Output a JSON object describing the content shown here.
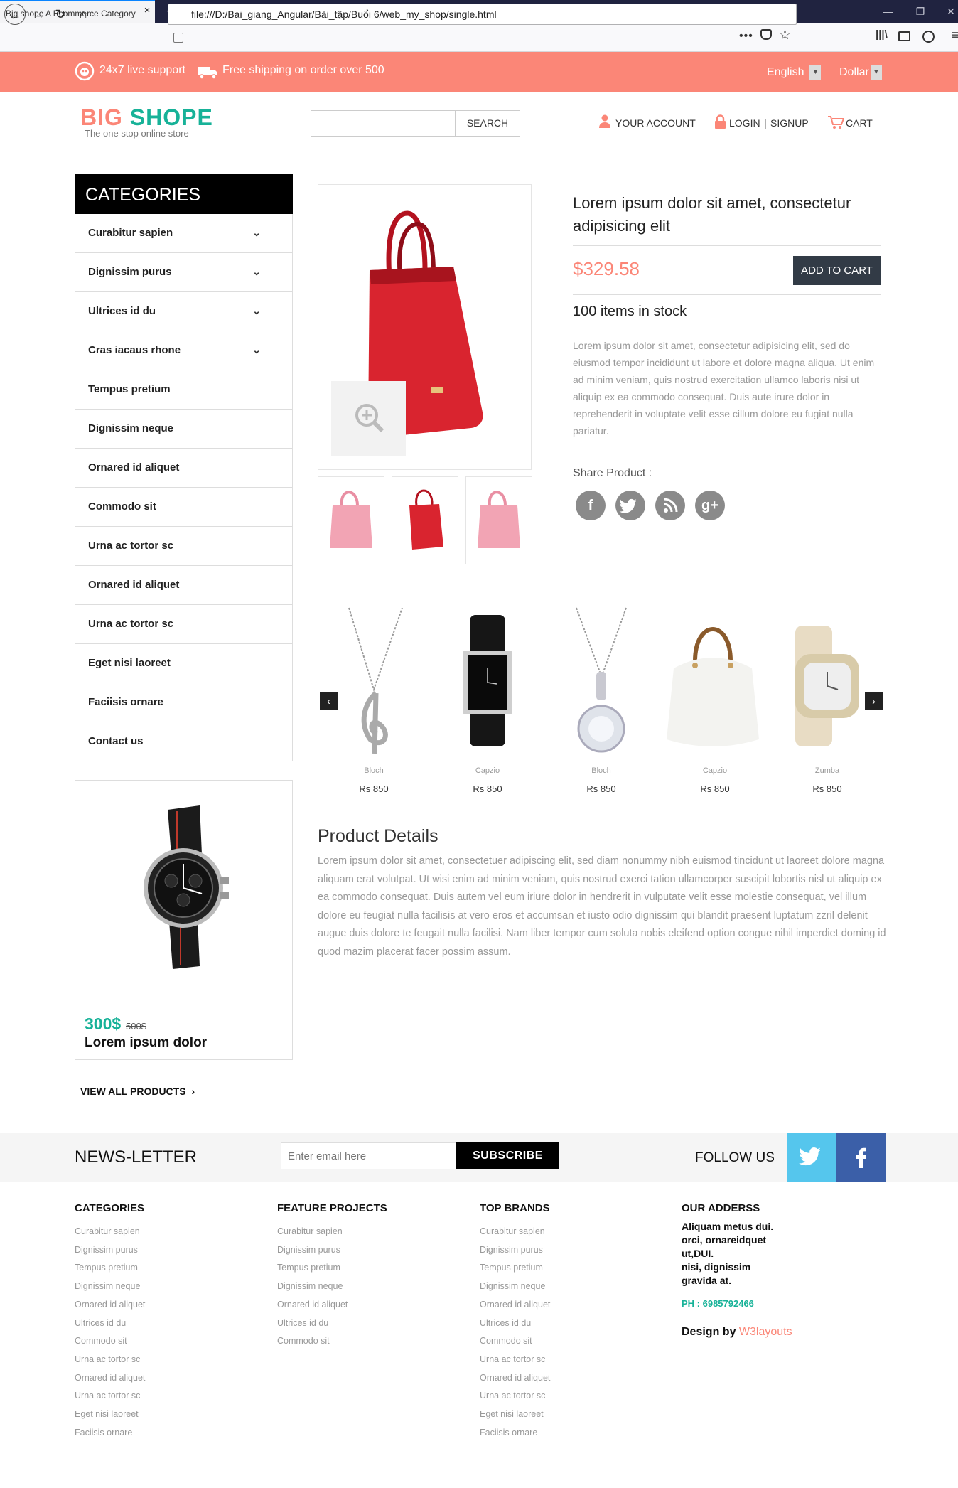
{
  "browser": {
    "tab_title": "Big shope A Ecommerce Category",
    "tab_close": "×",
    "new_tab": "+",
    "url": "file:///D:/Bai_giang_Angular/Bài_tập/Buổi 6/web_my_shop/single.html"
  },
  "topbar": {
    "support": "24x7 live support",
    "shipping": "Free shipping on order over 500",
    "language": "English",
    "currency": "Dollar"
  },
  "header": {
    "logo_word1": "BIG",
    "logo_word2": "SHOPE",
    "logo_tagline": "The one stop online store",
    "search_placeholder": "",
    "search_button": "SEARCH",
    "account": "YOUR ACCOUNT",
    "login": "LOGIN",
    "signup": "SIGNUP",
    "separator": "|",
    "cart": "CART"
  },
  "categories": {
    "title": "CATEGORIES",
    "items": [
      {
        "label": "Curabitur sapien",
        "chevron": "⌄"
      },
      {
        "label": "Dignissim purus",
        "chevron": "⌄"
      },
      {
        "label": "Ultrices id du",
        "chevron": "⌄"
      },
      {
        "label": "Cras iacaus rhone",
        "chevron": "⌄"
      },
      {
        "label": "Tempus pretium"
      },
      {
        "label": "Dignissim neque"
      },
      {
        "label": "Ornared id aliquet"
      },
      {
        "label": "Commodo sit"
      },
      {
        "label": "Urna ac tortor sc"
      },
      {
        "label": "Ornared id aliquet"
      },
      {
        "label": "Urna ac tortor sc"
      },
      {
        "label": "Eget nisi laoreet"
      },
      {
        "label": "Faciisis ornare"
      },
      {
        "label": "Contact us"
      }
    ]
  },
  "featured": {
    "price": "300$",
    "old_price": "500$",
    "name": "Lorem ipsum dolor",
    "view_all": "VIEW ALL PRODUCTS",
    "view_all_arrow": "›"
  },
  "product": {
    "title": "Lorem ipsum dolor sit amet, consectetur adipisicing elit",
    "price": "$329.58",
    "add_to_cart": "ADD TO CART",
    "stock": "100 items in stock",
    "description": "Lorem ipsum dolor sit amet, consectetur adipisicing elit, sed do eiusmod tempor incididunt ut labore et dolore magna aliqua. Ut enim ad minim veniam, quis nostrud exercitation ullamco laboris nisi ut aliquip ex ea commodo consequat. Duis aute irure dolor in reprehenderit in voluptate velit esse cillum dolore eu fugiat nulla pariatur.",
    "share_label": "Share Product :",
    "social": {
      "facebook": "f",
      "twitter": "t",
      "rss": "r",
      "google": "g+"
    }
  },
  "carousel": {
    "prev": "‹",
    "next": "›",
    "items": [
      {
        "name": "Bloch",
        "price": "Rs 850"
      },
      {
        "name": "Capzio",
        "price": "Rs 850"
      },
      {
        "name": "Bloch",
        "price": "Rs 850"
      },
      {
        "name": "Capzio",
        "price": "Rs 850"
      },
      {
        "name": "Zumba",
        "price": "Rs 850"
      }
    ]
  },
  "details": {
    "title": "Product Details",
    "text": "Lorem ipsum dolor sit amet, consectetuer adipiscing elit, sed diam nonummy nibh euismod tincidunt ut laoreet dolore magna aliquam erat volutpat. Ut wisi enim ad minim veniam, quis nostrud exerci tation ullamcorper suscipit lobortis nisl ut aliquip ex ea commodo consequat. Duis autem vel eum iriure dolor in hendrerit in vulputate velit esse molestie consequat, vel illum dolore eu feugiat nulla facilisis at vero eros et accumsan et iusto odio dignissim qui blandit praesent luptatum zzril delenit augue duis dolore te feugait nulla facilisi. Nam liber tempor cum soluta nobis eleifend option congue nihil imperdiet doming id quod mazim placerat facer possim assum."
  },
  "newsletter": {
    "label": "NEWS-LETTER",
    "placeholder": "Enter email here",
    "button": "SUBSCRIBE",
    "follow": "FOLLOW US"
  },
  "footer": {
    "categories": {
      "title": "CATEGORIES",
      "items": [
        "Curabitur sapien",
        "Dignissim purus",
        "Tempus pretium",
        "Dignissim neque",
        "Ornared id aliquet",
        "Ultrices id du",
        "Commodo sit",
        "Urna ac tortor sc",
        "Ornared id aliquet",
        "Urna ac tortor sc",
        "Eget nisi laoreet",
        "Faciisis ornare"
      ]
    },
    "projects": {
      "title": "FEATURE PROJECTS",
      "items": [
        "Curabitur sapien",
        "Dignissim purus",
        "Tempus pretium",
        "Dignissim neque",
        "Ornared id aliquet",
        "Ultrices id du",
        "Commodo sit"
      ]
    },
    "brands": {
      "title": "TOP BRANDS",
      "items": [
        "Curabitur sapien",
        "Dignissim purus",
        "Tempus pretium",
        "Dignissim neque",
        "Ornared id aliquet",
        "Ultrices id du",
        "Commodo sit",
        "Urna ac tortor sc",
        "Ornared id aliquet",
        "Urna ac tortor sc",
        "Eget nisi laoreet",
        "Faciisis ornare"
      ]
    },
    "address": {
      "title": "OUR ADDERSS",
      "lines": [
        "Aliquam metus dui.",
        "orci, ornareidquet",
        "ut,DUI.",
        "nisi, dignissim",
        "gravida at."
      ],
      "phone": "PH : 6985792466",
      "design_by": "Design by",
      "design_link": "W3layouts"
    }
  },
  "colors": {
    "accent": "#fb8677",
    "teal": "#17b298",
    "dark_button": "#323b46",
    "twitter": "#55c6ed",
    "facebook": "#3b5fa8"
  }
}
